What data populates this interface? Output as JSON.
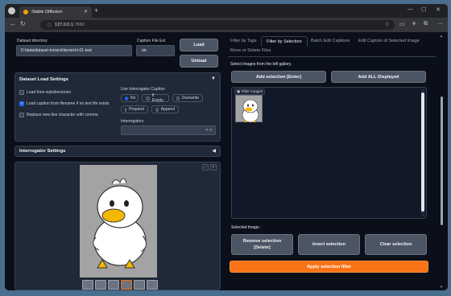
{
  "browser": {
    "tab_title": "Stable Diffusion",
    "url_host": "127.0.0.1",
    "url_port": ":7860"
  },
  "left": {
    "dataset_dir_label": "Dataset directory",
    "dataset_dir_value": "D:\\data\\dataset-torisichi\\torisichi-01-test",
    "caption_ext_label": "Caption File Ext",
    "caption_ext_value": ".txt",
    "load_button": "Load",
    "unload_button": "Unload",
    "load_settings_title": "Dataset Load Settings",
    "load_subdirs": "Load from subdirectories",
    "load_caption_from_filename": "Load caption from filename if no text file exists",
    "replace_newline": "Replace new-line character with comma",
    "use_interrogator_caption": "Use Interrogator Caption",
    "radio_options": [
      "No",
      "If Empty",
      "Overwrite",
      "Prepend",
      "Append"
    ],
    "radio_selected": "No",
    "interrogators_label": "Interrogators",
    "interrogator_settings_title": "Interrogator Settings"
  },
  "right": {
    "tabs": [
      "Filter by Tags",
      "Filter by Selection",
      "Batch Edit Captions",
      "Edit Caption of Selected Image",
      "Move or Delete Files"
    ],
    "active_tab": "Filter by Selection",
    "instruction": "Select images from the left gallery.",
    "add_selection_button": "Add selection [Enter]",
    "add_all_button": "Add ALL Displayed",
    "filter_images_label": "Filter Images",
    "selected_image_label": "Selected Image :",
    "remove_selection_button": "Remove selection",
    "remove_selection_hint": "[Delete]",
    "invert_selection_button": "Invert selection",
    "clear_selection_button": "Clear selection",
    "apply_filter_button": "Apply selection filter"
  },
  "colors": {
    "accent_orange": "#f97316",
    "checkbox_blue": "#2563eb",
    "page_bg": "#0b0f19",
    "panel_bg": "#1f2937"
  }
}
